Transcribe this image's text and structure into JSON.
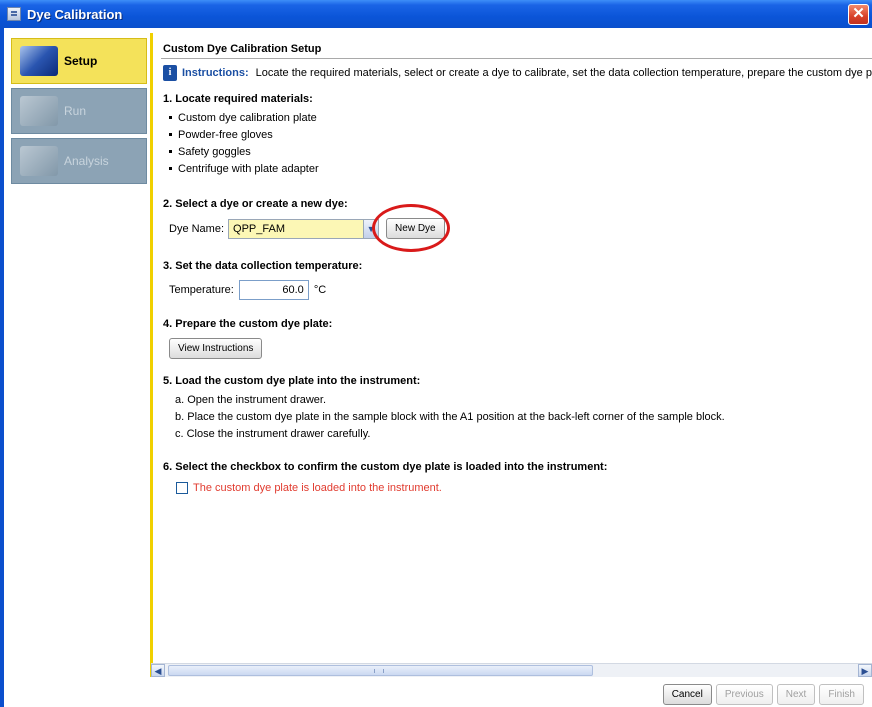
{
  "window": {
    "title": "Dye Calibration",
    "close_glyph": "✕"
  },
  "sidebar": {
    "items": [
      {
        "label": "Setup",
        "icon": "setup-icon",
        "state": "active"
      },
      {
        "label": "Run",
        "icon": "run-icon",
        "state": "inactive"
      },
      {
        "label": "Analysis",
        "icon": "analysis-icon",
        "state": "inactive"
      }
    ]
  },
  "main": {
    "title": "Custom Dye Calibration Setup",
    "instructions_label": "Instructions:",
    "instructions_text": "Locate the required materials, select or create a dye to calibrate, set the data collection temperature, prepare the custom dye plate",
    "step1": {
      "heading": "1. Locate required materials:",
      "items": [
        "Custom dye calibration plate",
        "Powder-free gloves",
        "Safety goggles",
        "Centrifuge with plate adapter"
      ]
    },
    "step2": {
      "heading": "2. Select a dye or create a new dye:",
      "dye_label": "Dye Name:",
      "dye_value": "QPP_FAM",
      "new_dye_button": "New Dye"
    },
    "step3": {
      "heading": "3. Set the data collection temperature:",
      "temp_label": "Temperature:",
      "temp_value": "60.0",
      "temp_unit": "°C"
    },
    "step4": {
      "heading": "4. Prepare the custom dye plate:",
      "button": "View Instructions"
    },
    "step5": {
      "heading": "5. Load the custom dye plate into the instrument:",
      "items": [
        "a. Open the instrument drawer.",
        "b. Place the custom dye plate in the sample block with the A1 position at the back-left corner of the sample block.",
        "c. Close the instrument drawer carefully."
      ]
    },
    "step6": {
      "heading": "6. Select the checkbox to confirm the custom dye plate is loaded into the instrument:",
      "checkbox_label": "The custom dye plate is loaded into the instrument.",
      "checked": false
    }
  },
  "footer": {
    "cancel": "Cancel",
    "previous": "Previous",
    "next": "Next",
    "finish": "Finish"
  },
  "colors": {
    "accent_yellow": "#f0d000",
    "highlight_ring": "#d91a1a",
    "checkbox_text": "#e13b2f",
    "title_bar": "#0b55d8"
  }
}
